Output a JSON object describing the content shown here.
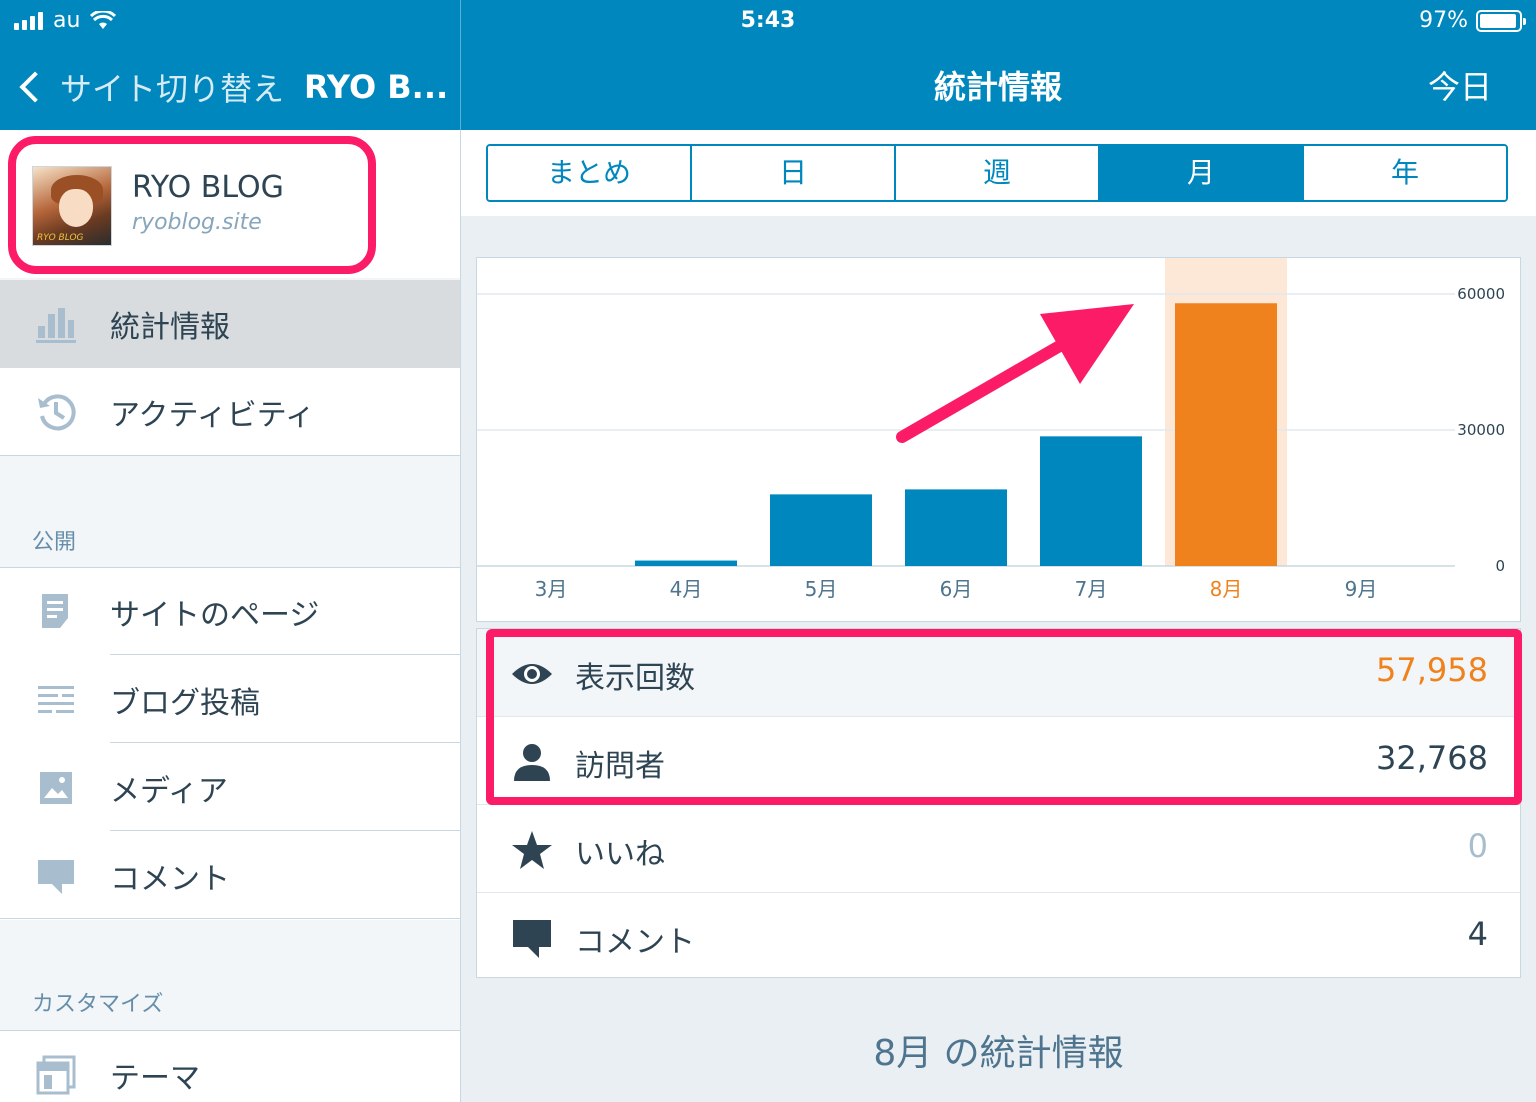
{
  "status": {
    "carrier": "au",
    "time": "5:43",
    "battery": "97%"
  },
  "nav": {
    "back_label": "サイト切り替え",
    "site_short": "RYO B...",
    "title": "統計情報",
    "today_label": "今日"
  },
  "site": {
    "name": "RYO BLOG",
    "url": "ryoblog.site",
    "avatar_caption": "RYO BLOG"
  },
  "sidebar": {
    "items": [
      {
        "label": "統計情報",
        "icon": "stats-icon",
        "active": true
      },
      {
        "label": "アクティビティ",
        "icon": "history-icon"
      }
    ],
    "sections": [
      {
        "title": "公開",
        "items": [
          {
            "label": "サイトのページ",
            "icon": "page-icon"
          },
          {
            "label": "ブログ投稿",
            "icon": "posts-icon"
          },
          {
            "label": "メディア",
            "icon": "image-icon"
          },
          {
            "label": "コメント",
            "icon": "comment-icon"
          }
        ]
      },
      {
        "title": "カスタマイズ",
        "items": [
          {
            "label": "テーマ",
            "icon": "themes-icon"
          }
        ]
      }
    ]
  },
  "period_tabs": {
    "options": [
      "まとめ",
      "日",
      "週",
      "月",
      "年"
    ],
    "selected": "月"
  },
  "chart_data": {
    "type": "bar",
    "categories": [
      "3月",
      "4月",
      "5月",
      "6月",
      "7月",
      "8月",
      "9月"
    ],
    "values": [
      0,
      1200,
      15800,
      16900,
      28600,
      57958,
      0
    ],
    "selected_index": 5,
    "y_ticks": [
      "60000",
      "30000",
      "0"
    ],
    "ylim": [
      0,
      68000
    ],
    "grid": true,
    "colors": {
      "bar": "#0087be",
      "selected": "#f0821e",
      "selected_bg": "#fde8d8"
    }
  },
  "stats": {
    "rows": [
      {
        "label": "表示回数",
        "value": "57,958",
        "icon": "eye-icon",
        "color": "#f0821e"
      },
      {
        "label": "訪問者",
        "value": "32,768",
        "icon": "person-icon",
        "color": "#2e4453"
      },
      {
        "label": "いいね",
        "value": "0",
        "icon": "star-icon",
        "color": "#a8bece"
      },
      {
        "label": "コメント",
        "value": "4",
        "icon": "comment-icon",
        "color": "#2e4453"
      }
    ]
  },
  "footer": {
    "title": "8月 の統計情報"
  },
  "colors": {
    "accent": "#0087be",
    "highlight": "#fb1b67"
  }
}
